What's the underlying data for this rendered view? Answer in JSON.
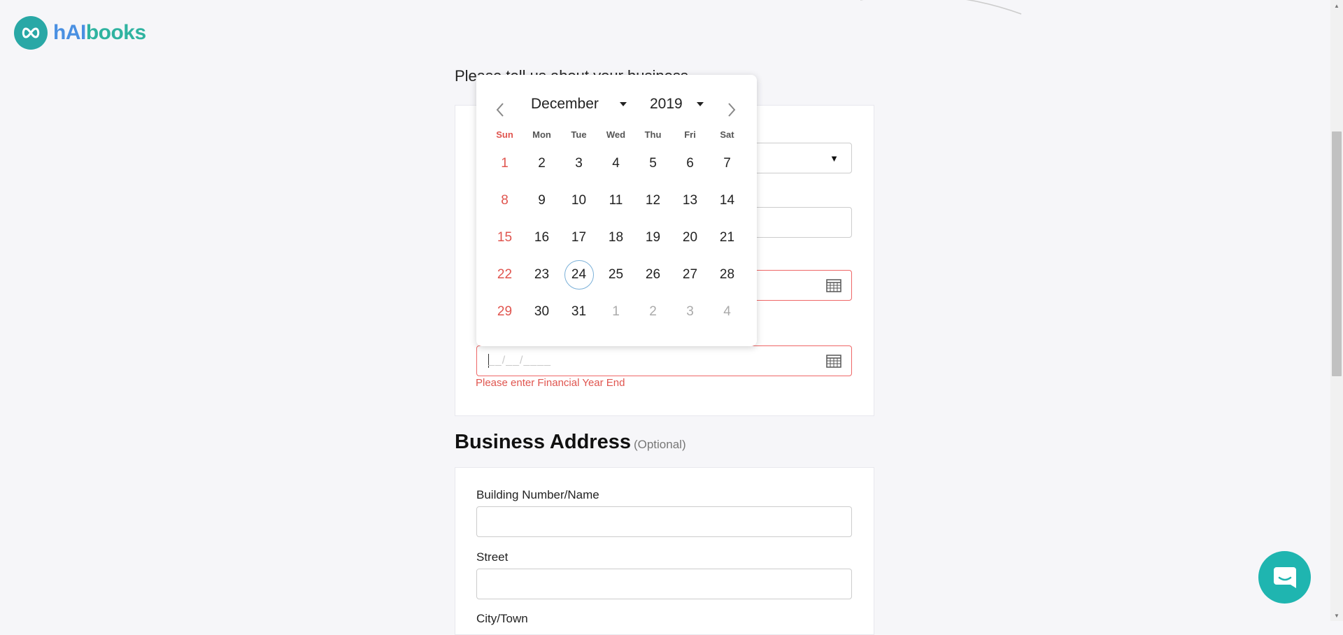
{
  "brand": {
    "logo_text_h": "hAI",
    "logo_text_rest": "books",
    "color": "#29a8a6"
  },
  "form": {
    "heading": "Please tell us about your business",
    "date_mask": "__/__/____",
    "financial_year_error": "Please enter Financial Year End"
  },
  "address": {
    "title": "Business Address",
    "optional": "(Optional)",
    "building_label": "Building Number/Name",
    "street_label": "Street",
    "city_label": "City/Town"
  },
  "calendar": {
    "month": "December",
    "year": "2019",
    "weekdays": [
      "Sun",
      "Mon",
      "Tue",
      "Wed",
      "Thu",
      "Fri",
      "Sat"
    ],
    "today": "24",
    "weeks": [
      [
        "1",
        "2",
        "3",
        "4",
        "5",
        "6",
        "7"
      ],
      [
        "8",
        "9",
        "10",
        "11",
        "12",
        "13",
        "14"
      ],
      [
        "15",
        "16",
        "17",
        "18",
        "19",
        "20",
        "21"
      ],
      [
        "22",
        "23",
        "24",
        "25",
        "26",
        "27",
        "28"
      ],
      [
        "29",
        "30",
        "31",
        "1",
        "2",
        "3",
        "4"
      ]
    ],
    "other_month_cells": [
      [
        4,
        3
      ],
      [
        4,
        4
      ],
      [
        4,
        5
      ],
      [
        4,
        6
      ]
    ]
  },
  "colors": {
    "error": "#e0554f",
    "accent": "#1fb5b0",
    "sunday": "#e0554f"
  },
  "icons": {
    "chat": "chat-icon",
    "calendar": "calendar-icon",
    "prev": "chevron-left-icon",
    "next": "chevron-right-icon"
  }
}
